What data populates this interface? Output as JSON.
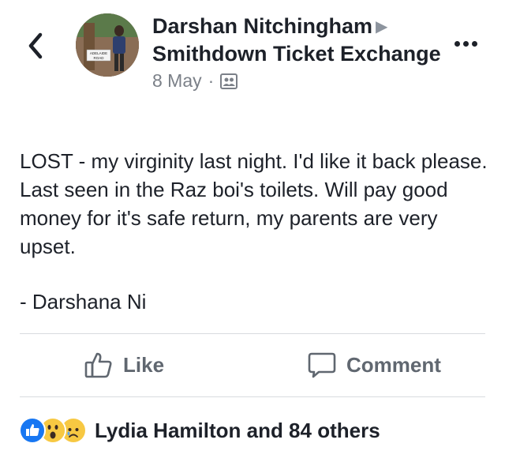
{
  "post": {
    "author": "Darshan Nitchingham",
    "group": "Smithdown Ticket Exchange",
    "date": "8 May",
    "separator": "·",
    "audience_icon": "group-audience-icon",
    "avatar_sign": [
      "ADELAIDE",
      "ROAD"
    ],
    "body": [
      "LOST - my virginity last night. I'd like it back please. Last seen in the Raz boi's toilets. Will pay good money for it's safe return, my parents are very upset."
    ],
    "signature": "- Darshana Ni"
  },
  "actions": {
    "like_label": "Like",
    "comment_label": "Comment"
  },
  "reactions": {
    "icons": [
      "like-reaction-icon",
      "wow-reaction-icon",
      "sad-reaction-icon"
    ],
    "summary": "Lydia Hamilton and 84 others"
  },
  "colors": {
    "text": "#1d2129",
    "secondary": "#7b8088",
    "action": "#606770",
    "like_blue": "#1877f2",
    "emoji_yellow": "#f7c842"
  }
}
